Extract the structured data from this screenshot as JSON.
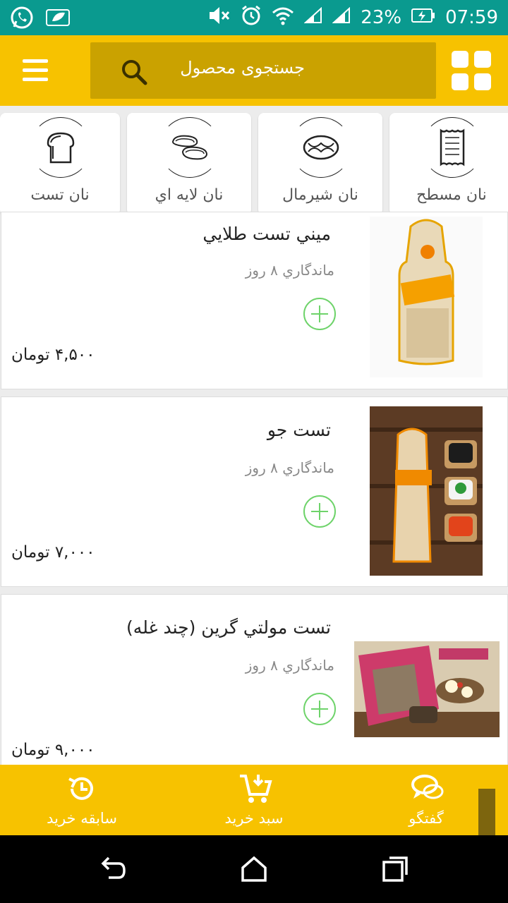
{
  "status_bar": {
    "battery_percent": "23%",
    "time": "07:59",
    "icons": [
      "whatsapp-icon",
      "leaf-icon",
      "mute-icon",
      "alarm-icon",
      "wifi-icon",
      "signal-icon",
      "signal-icon",
      "battery-charging-icon"
    ]
  },
  "header": {
    "search_placeholder": "جستجوی محصول",
    "icons": [
      "grid-icon",
      "search-icon",
      "menu-icon"
    ]
  },
  "categories": [
    {
      "label": "نان  تست",
      "icon": "toast-bread-icon",
      "selected": true
    },
    {
      "label": "نان لایه اي",
      "icon": "layered-bread-icon",
      "selected": false
    },
    {
      "label": "نان شيرمال",
      "icon": "braided-bread-icon",
      "selected": false
    },
    {
      "label": "نان مسطح",
      "icon": "flat-bread-icon",
      "selected": false
    }
  ],
  "products": [
    {
      "name": "ميني تست طلايي",
      "shelf_life": "ماندگاري ۸ روز",
      "price": "۴,۵۰۰ تومان"
    },
    {
      "name": "تست جو",
      "shelf_life": "ماندگاري ۸ روز",
      "price": "۷,۰۰۰ تومان"
    },
    {
      "name": "تست مولتي گرين (چند غله)",
      "shelf_life": "ماندگاري ۸ روز",
      "price": "۹,۰۰۰ تومان"
    }
  ],
  "bottom_nav": [
    {
      "label": "سابقه خريد",
      "icon": "history-icon"
    },
    {
      "label": "سبد خريد",
      "icon": "cart-icon"
    },
    {
      "label": "گفتگو",
      "icon": "chat-icon"
    }
  ],
  "colors": {
    "status_bar": "#0a9a8f",
    "brand_yellow": "#f7c200",
    "search_bg": "#caa200",
    "add_green": "#6ed36a"
  }
}
